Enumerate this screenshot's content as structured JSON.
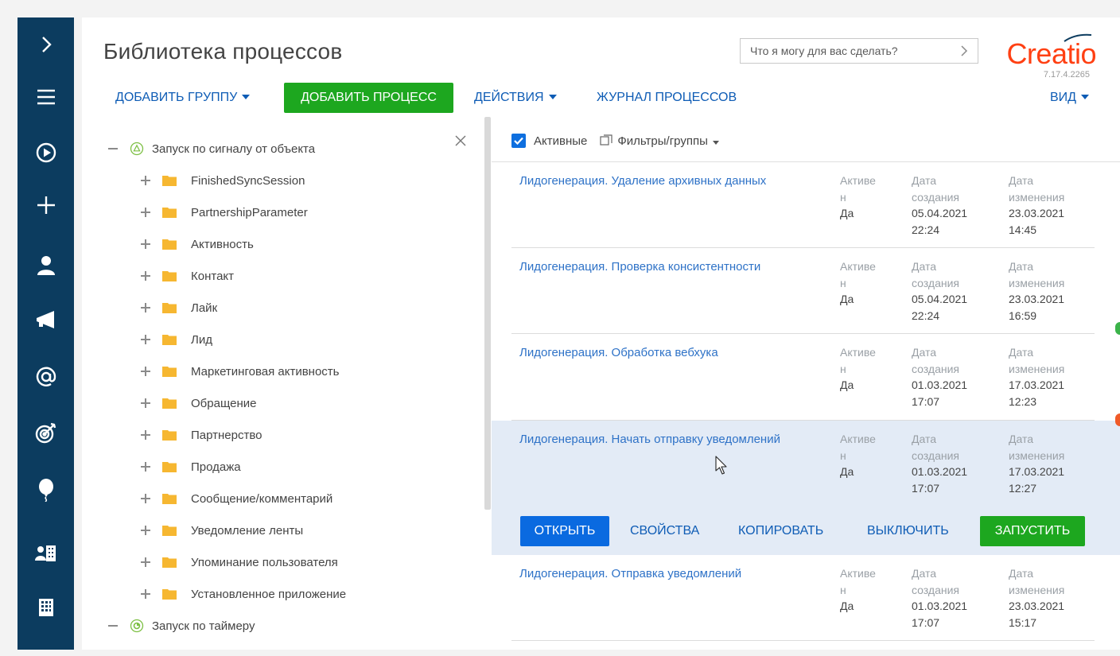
{
  "page": {
    "title": "Библиотека процессов",
    "command_placeholder": "Что я могу для вас сделать?",
    "logo_text": "Creatio",
    "version": "7.17.4.2265"
  },
  "toolbar": {
    "add_group": "ДОБАВИТЬ ГРУППУ",
    "add_process": "ДОБАВИТЬ ПРОЦЕСС",
    "actions": "ДЕЙСТВИЯ",
    "process_log": "ЖУРНАЛ ПРОЦЕССОВ",
    "view": "ВИД"
  },
  "tree": {
    "root1": "Запуск по сигналу от объекта",
    "children": [
      "FinishedSyncSession",
      "PartnershipParameter",
      "Активность",
      "Контакт",
      "Лайк",
      "Лид",
      "Маркетинговая активность",
      "Обращение",
      "Партнерство",
      "Продажа",
      "Сообщение/комментарий",
      "Уведомление ленты",
      "Упоминание пользователя",
      "Установленное приложение"
    ],
    "root2": "Запуск по таймеру"
  },
  "filters": {
    "active": "Активные",
    "filters_groups": "Фильтры/группы"
  },
  "labels": {
    "active_a": "Активе",
    "active_b": "н",
    "created_a": "Дата",
    "created_b": "создания",
    "modified_a": "Дата",
    "modified_b": "изменения"
  },
  "rows": [
    {
      "name": "Лидогенерация. Удаление архивных данных",
      "active": "Да",
      "created_date": "05.04.2021",
      "created_time": "22:24",
      "modified_date": "23.03.2021",
      "modified_time": "14:45"
    },
    {
      "name": "Лидогенерация. Проверка консистентности",
      "active": "Да",
      "created_date": "05.04.2021",
      "created_time": "22:24",
      "modified_date": "23.03.2021",
      "modified_time": "16:59"
    },
    {
      "name": "Лидогенерация. Обработка вебхука",
      "active": "Да",
      "created_date": "01.03.2021",
      "created_time": "17:07",
      "modified_date": "17.03.2021",
      "modified_time": "12:23"
    },
    {
      "name": "Лидогенерация. Начать отправку уведомлений",
      "active": "Да",
      "created_date": "01.03.2021",
      "created_time": "17:07",
      "modified_date": "17.03.2021",
      "modified_time": "12:27"
    },
    {
      "name": "Лидогенерация. Отправка уведомлений",
      "active": "Да",
      "created_date": "01.03.2021",
      "created_time": "17:07",
      "modified_date": "23.03.2021",
      "modified_time": "15:17"
    }
  ],
  "row_actions": {
    "open": "ОТКРЫТЬ",
    "properties": "СВОЙСТВА",
    "copy": "КОПИРОВАТЬ",
    "disable": "ВЫКЛЮЧИТЬ",
    "run": "ЗАПУСТИТЬ"
  },
  "icons": {
    "rail": [
      "chevron-right-icon",
      "menu-icon",
      "play-icon",
      "plus-icon",
      "user-icon",
      "megaphone-icon",
      "at-icon",
      "target-icon",
      "balloon-icon",
      "accounts-icon",
      "building-icon"
    ],
    "tree": [
      "signal-icon",
      "folder-icon",
      "timer-icon"
    ]
  },
  "colors": {
    "rail": "#0c3c5f",
    "link": "#0e5cb5",
    "green": "#1da71f",
    "primary_blue": "#0a6ae0",
    "selected_row": "#e3ebf6",
    "folder": "#f6b731",
    "logo": "#ff4013"
  }
}
